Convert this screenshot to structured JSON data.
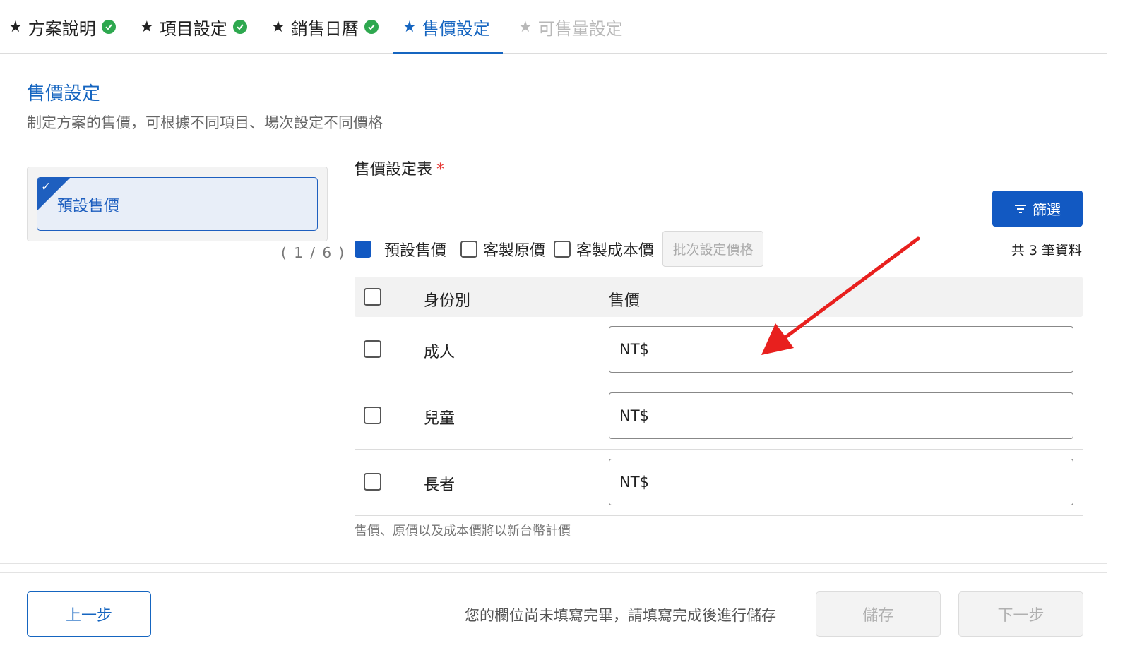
{
  "tabs": [
    {
      "label": "方案說明",
      "state": "done"
    },
    {
      "label": "項目設定",
      "state": "done"
    },
    {
      "label": "銷售日曆",
      "state": "done"
    },
    {
      "label": "售價設定",
      "state": "active"
    },
    {
      "label": "可售量設定",
      "state": "disabled"
    }
  ],
  "section": {
    "title": "售價設定",
    "description": "制定方案的售價，可根據不同項目、場次設定不同價格"
  },
  "left": {
    "card_label": "預設售價",
    "pager": "( 1 / 6 )"
  },
  "table": {
    "title": "售價設定表",
    "required_mark": "*",
    "filter_label": "篩選",
    "options": [
      {
        "label": "預設售價",
        "checked": true
      },
      {
        "label": "客製原價",
        "checked": false
      },
      {
        "label": "客製成本價",
        "checked": false
      }
    ],
    "batch_label": "批次設定價格",
    "count_label": "共 3 筆資料",
    "headers": {
      "identity": "身份別",
      "price": "售價"
    },
    "rows": [
      {
        "identity": "成人",
        "price_prefix": "NT$"
      },
      {
        "identity": "兒童",
        "price_prefix": "NT$"
      },
      {
        "identity": "長者",
        "price_prefix": "NT$"
      }
    ],
    "note": "售價、原價以及成本價將以新台幣計價"
  },
  "footer": {
    "prev_label": "上一步",
    "hint": "您的欄位尚未填寫完畢，請填寫完成後進行儲存",
    "save_label": "儲存",
    "next_label": "下一步"
  },
  "colors": {
    "accent": "#1565c0",
    "primary_button": "#1259c2",
    "success": "#2ea84f",
    "required": "#e53935",
    "annotation_arrow": "#e8201e"
  }
}
